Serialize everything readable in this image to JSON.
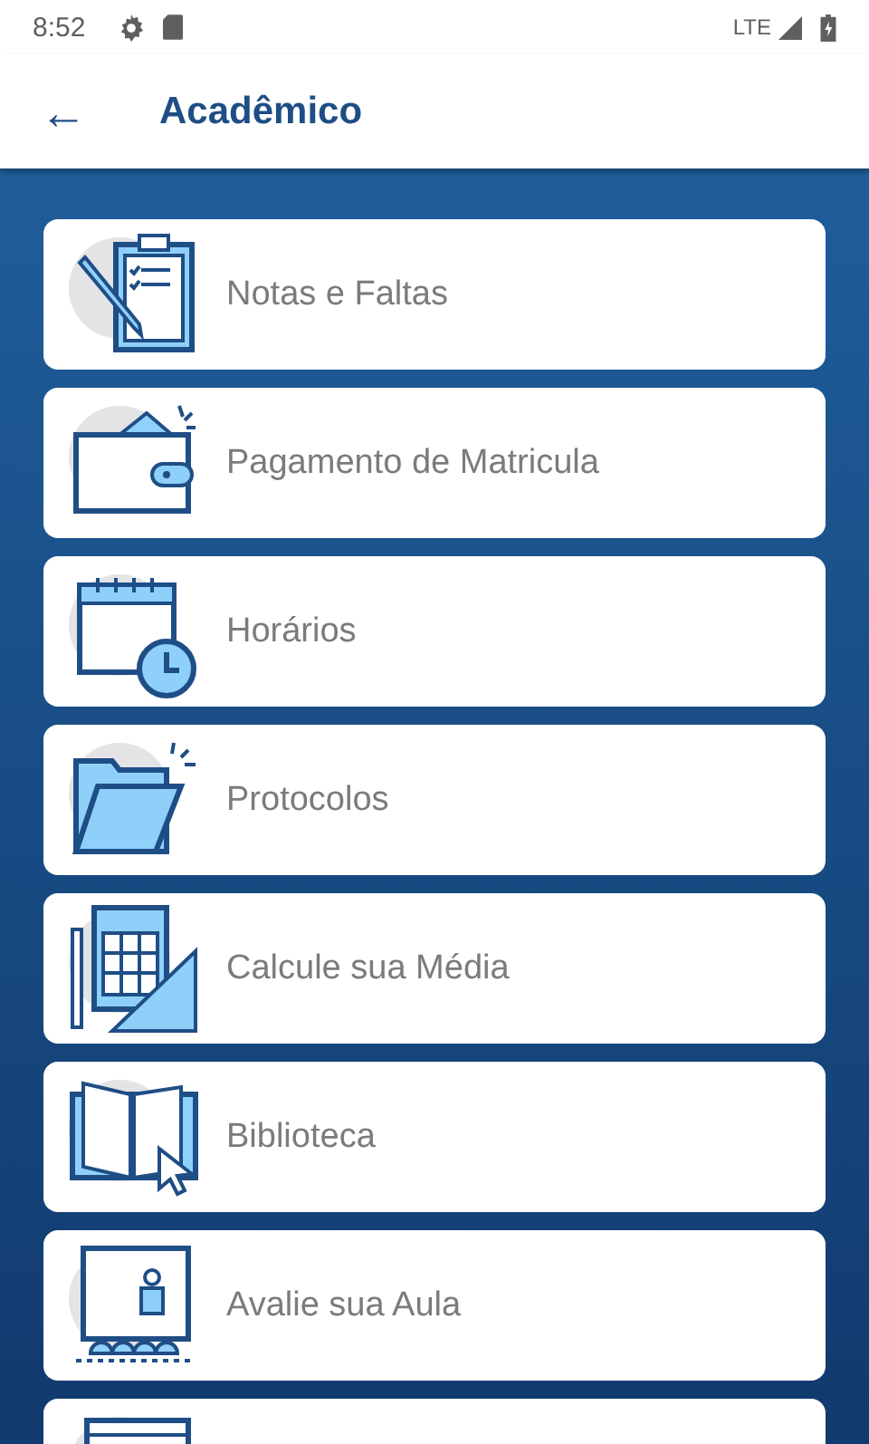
{
  "status_bar": {
    "time": "8:52",
    "network": "LTE"
  },
  "app_bar": {
    "back": "←",
    "title": "Acadêmico"
  },
  "items": [
    {
      "kind": "full",
      "label": "Notas e Faltas"
    },
    {
      "kind": "full",
      "label": "Pagamento de Matricula"
    },
    {
      "kind": "full",
      "label": "Horários"
    },
    {
      "kind": "full",
      "label": "Protocolos"
    },
    {
      "kind": "full",
      "label": "Calcule sua Média"
    },
    {
      "kind": "full",
      "label": "Biblioteca"
    },
    {
      "kind": "full",
      "label": "Avalie sua Aula"
    },
    {
      "kind": "cut"
    }
  ]
}
